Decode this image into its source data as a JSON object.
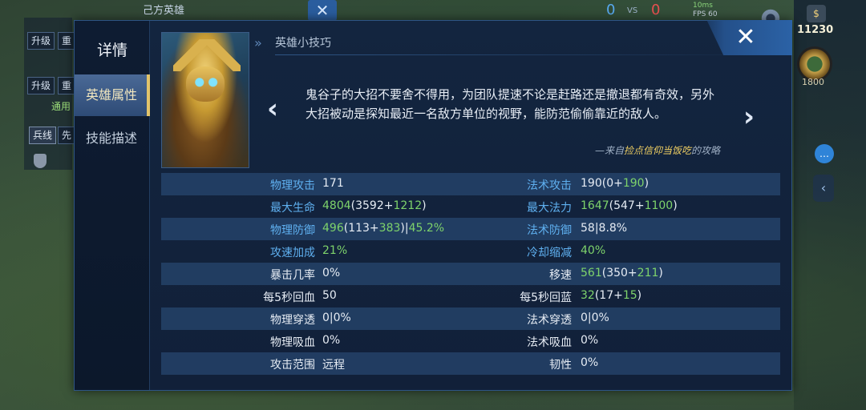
{
  "hud": {
    "team_title": "己方英雄",
    "upgrade_label_1": "升级",
    "reset_label_1": "重置",
    "upgrade_label_2": "升级",
    "reset_label_2": "重置",
    "common_label": "通用",
    "minion_label": "兵线",
    "first_label": "先知",
    "score_left": "0",
    "vs": "VS",
    "score_right": "0",
    "network": "10ms",
    "fps": "FPS 60",
    "gold": "11230",
    "item_price": "1800"
  },
  "dialog": {
    "title": "详情",
    "tabs": [
      {
        "label": "英雄属性",
        "active": true
      },
      {
        "label": "技能描述",
        "active": false
      }
    ],
    "tip": {
      "header": "英雄小技巧",
      "text": "鬼谷子的大招不要舍不得用，为团队提速不论是赶路还是撤退都有奇效，另外大招被动是探知最近一名敌方单位的视野，能防范偷偷靠近的敌人。",
      "source_prefix": "—来自",
      "source_author": "捡点信仰当饭吃",
      "source_suffix": "的攻略"
    },
    "stats": [
      {
        "left_label": "物理攻击",
        "left_value": "171",
        "right_label": "法术攻击",
        "right_value": "190(0+190)"
      },
      {
        "left_label": "最大生命",
        "left_value": "4804(3592+1212)",
        "right_label": "最大法力",
        "right_value": "1647(547+1100)"
      },
      {
        "left_label": "物理防御",
        "left_value": "496(113+383)|45.2%",
        "right_label": "法术防御",
        "right_value": "58|8.8%"
      },
      {
        "left_label": "攻速加成",
        "left_value": "21%",
        "right_label": "冷却缩减",
        "right_value": "40%"
      },
      {
        "left_label": "暴击几率",
        "left_value": "0%",
        "right_label": "移速",
        "right_value": "561(350+211)"
      },
      {
        "left_label": "每5秒回血",
        "left_value": "50",
        "right_label": "每5秒回蓝",
        "right_value": "32(17+15)"
      },
      {
        "left_label": "物理穿透",
        "left_value": "0|0%",
        "right_label": "法术穿透",
        "right_value": "0|0%"
      },
      {
        "left_label": "物理吸血",
        "left_value": "0%",
        "right_label": "法术吸血",
        "right_value": "0%"
      },
      {
        "left_label": "攻击范围",
        "left_value": "远程",
        "right_label": "韧性",
        "right_value": "0%"
      }
    ]
  },
  "colors": {
    "panel": "#13253f",
    "row_highlight": "#254269",
    "label_blue": "#5fb0f0",
    "bonus_green": "#7ed36b",
    "active_tab": "#4a6996",
    "accent_gold": "#e2c46b"
  },
  "icons": {
    "close": "close-x-icon",
    "prev": "chevron-left-icon",
    "next": "chevron-right-icon",
    "tip": "double-chevron-icon"
  }
}
